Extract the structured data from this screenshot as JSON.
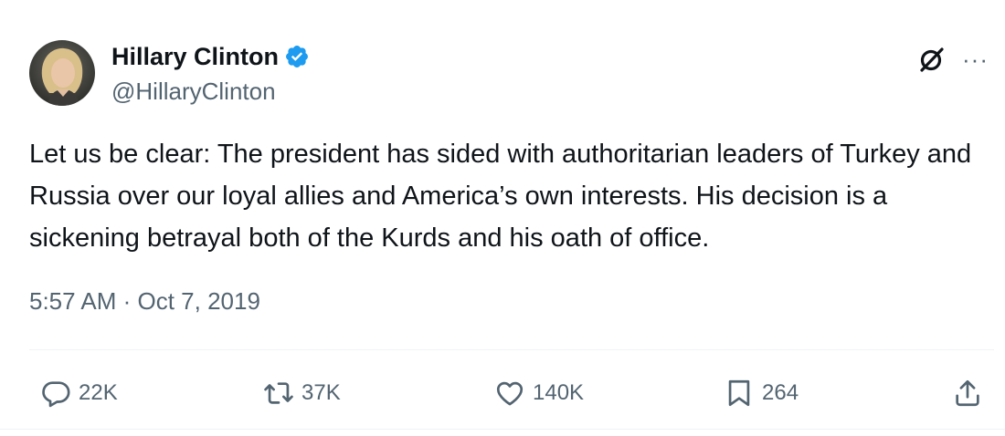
{
  "user": {
    "name": "Hillary Clinton",
    "handle": "@HillaryClinton",
    "verified": true,
    "verified_color": "#1d9bf0"
  },
  "tweet": {
    "text": "Let us be clear: The president has sided with authoritarian leaders of Turkey and Russia over our loyal allies and America’s own interests. His decision is a sickening betrayal both of the Kurds and his oath of office.",
    "timestamp": "5:57 AM · Oct 7, 2019"
  },
  "menu": {
    "more_label": "···"
  },
  "actions": {
    "replies": "22K",
    "reposts": "37K",
    "likes": "140K",
    "bookmarks": "264"
  },
  "icons": [
    "verified-badge-icon",
    "grok-icon",
    "more-icon",
    "reply-icon",
    "repost-icon",
    "like-icon",
    "bookmark-icon",
    "share-icon"
  ],
  "colors": {
    "text": "#0f1419",
    "secondary": "#536471",
    "accent": "#1d9bf0"
  }
}
